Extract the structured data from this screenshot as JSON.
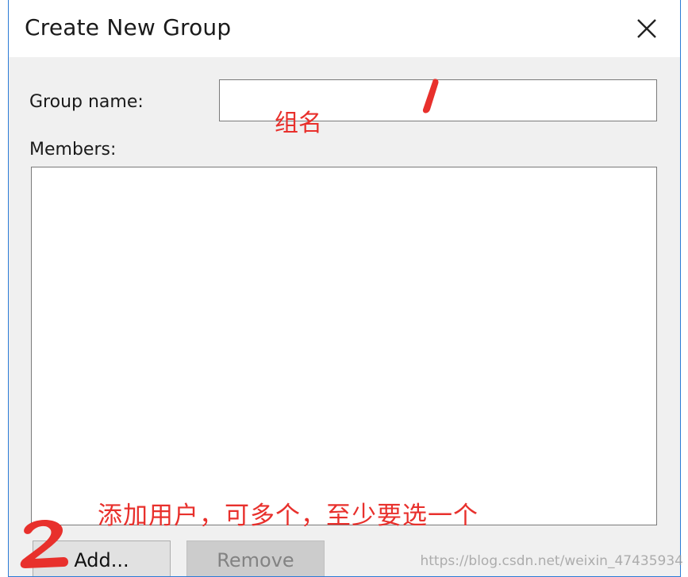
{
  "dialog": {
    "title": "Create New Group",
    "close_icon": "close-icon",
    "group_name_label": "Group name:",
    "group_name_value": "",
    "members_label": "Members:",
    "members": [],
    "add_button_label": "Add...",
    "remove_button_label": "Remove",
    "remove_enabled": false
  },
  "annotations": {
    "group_name_note": "组名",
    "add_note": "添加用户，可多个，至少要选一个",
    "marker_1": "1",
    "marker_2": "2",
    "color": "#e8302c"
  },
  "watermark": "https://blog.csdn.net/weixin_47435934",
  "colors": {
    "window_border": "#2b7bd6",
    "dialog_bg": "#f0f0f0",
    "titlebar_bg": "#ffffff"
  }
}
